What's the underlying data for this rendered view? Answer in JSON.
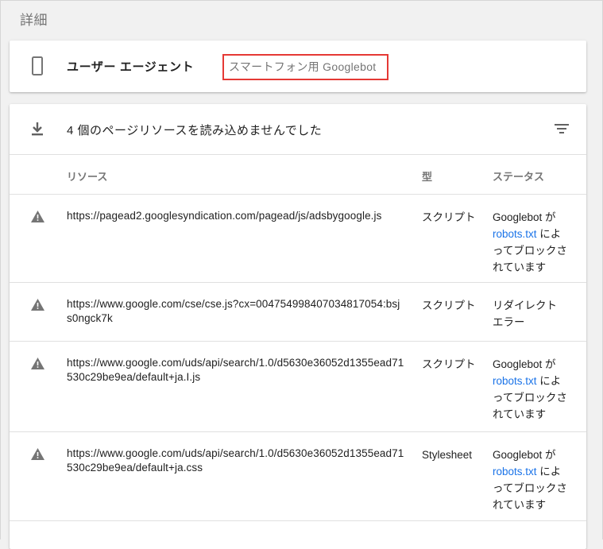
{
  "section": {
    "title": "詳細"
  },
  "user_agent": {
    "label": "ユーザー エージェント",
    "value": "スマートフォン用 Googlebot"
  },
  "resources": {
    "title": "4 個のページリソースを読み込めませんでした",
    "columns": {
      "resource": "リソース",
      "type": "型",
      "status": "ステータス"
    },
    "rows": [
      {
        "url": "https://pagead2.googlesyndication.com/pagead/js/adsbygoogle.js",
        "type": "スクリプト",
        "status_pre": "Googlebot が ",
        "status_link": "robots.txt",
        "status_post": " によってブロックされています"
      },
      {
        "url": "https://www.google.com/cse/cse.js?cx=004754998407034817054:bsjs0ngck7k",
        "type": "スクリプト",
        "status_pre": "リダイレクト エラー",
        "status_link": "",
        "status_post": ""
      },
      {
        "url": "https://www.google.com/uds/api/search/1.0/d5630e36052d1355ead71530c29be9ea/default+ja.I.js",
        "type": "スクリプト",
        "status_pre": "Googlebot が ",
        "status_link": "robots.txt",
        "status_post": " によってブロックされています"
      },
      {
        "url": "https://www.google.com/uds/api/search/1.0/d5630e36052d1355ead71530c29be9ea/default+ja.css",
        "type": "Stylesheet",
        "status_pre": "Googlebot が ",
        "status_link": "robots.txt",
        "status_post": " によってブロックされています"
      }
    ]
  },
  "icons": {
    "device": "smartphone-icon",
    "download": "download-icon",
    "filter": "filter-icon",
    "warning": "warning-icon"
  },
  "colors": {
    "highlight_border": "#e53935",
    "link": "#1a73e8",
    "icon": "#757575"
  }
}
